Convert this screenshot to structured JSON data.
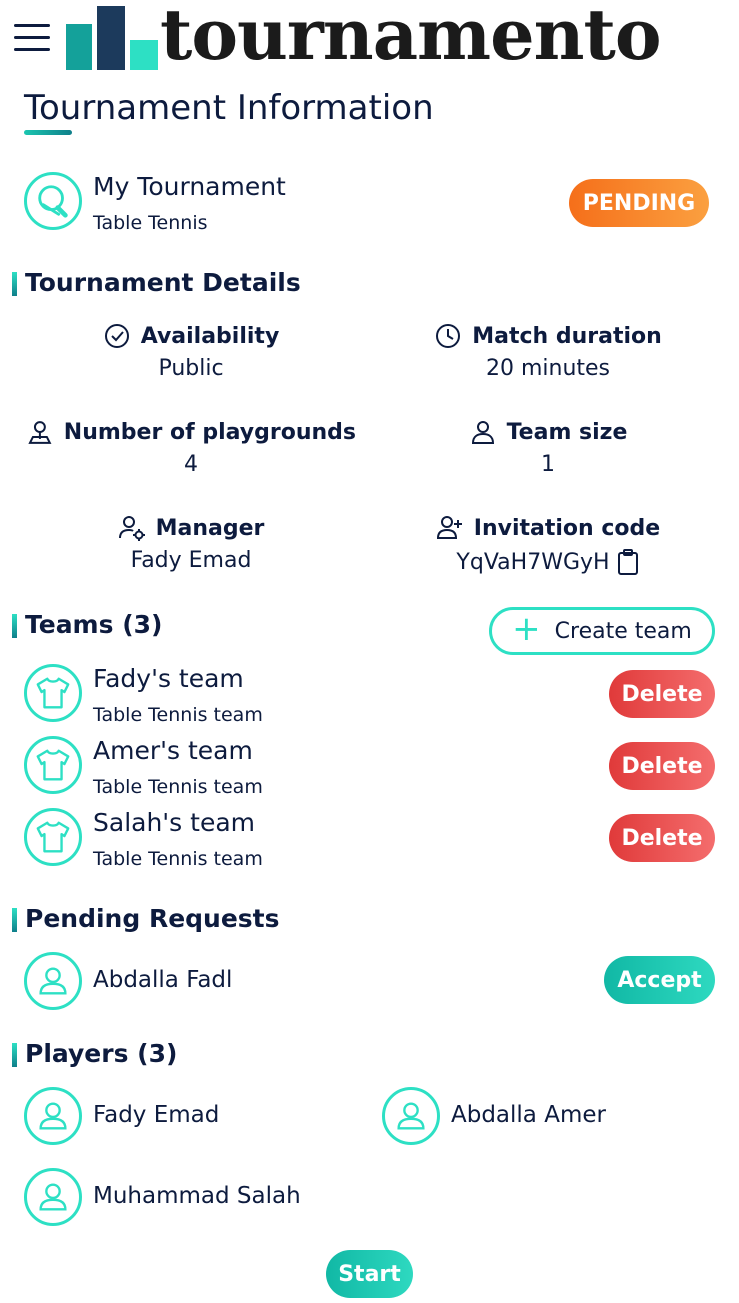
{
  "app": {
    "logo_text": "tournamento"
  },
  "page": {
    "title": "Tournament Information"
  },
  "tournament": {
    "name": "My Tournament",
    "sport": "Table Tennis",
    "status": "PENDING",
    "status_color": "#f5801f"
  },
  "details": {
    "title": "Tournament Details",
    "availability": {
      "label": "Availability",
      "value": "Public"
    },
    "match_duration": {
      "label": "Match duration",
      "value": "20 minutes"
    },
    "playgrounds": {
      "label": "Number of playgrounds",
      "value": "4"
    },
    "team_size": {
      "label": "Team size",
      "value": "1"
    },
    "manager": {
      "label": "Manager",
      "value": "Fady Emad"
    },
    "invitation": {
      "label": "Invitation code",
      "value": "YqVaH7WGyH"
    }
  },
  "teams": {
    "title": "Teams (3)",
    "create_label": "Create team",
    "delete_label": "Delete",
    "items": [
      {
        "name": "Fady's team",
        "sub": "Table Tennis team"
      },
      {
        "name": "Amer's team",
        "sub": "Table Tennis team"
      },
      {
        "name": "Salah's team",
        "sub": "Table Tennis team"
      }
    ]
  },
  "pending": {
    "title": "Pending Requests",
    "accept_label": "Accept",
    "items": [
      {
        "name": "Abdalla Fadl"
      }
    ]
  },
  "players": {
    "title": "Players (3)",
    "items": [
      {
        "name": "Fady Emad"
      },
      {
        "name": "Abdalla Amer"
      },
      {
        "name": "Muhammad Salah"
      }
    ]
  },
  "actions": {
    "start_label": "Start"
  },
  "colors": {
    "accent": "#2de0c4",
    "danger": "#e8474a",
    "navy": "#0d1b3e"
  },
  "icons": {
    "menu": "hamburger-icon",
    "sport": "ping-pong-paddle-icon",
    "availability": "check-circle-icon",
    "duration": "clock-icon",
    "playgrounds": "location-person-icon",
    "team_size": "person-icon",
    "manager": "person-gear-icon",
    "invitation": "person-add-icon",
    "copy": "clipboard-icon",
    "team": "tshirt-icon",
    "user": "user-avatar-icon"
  }
}
